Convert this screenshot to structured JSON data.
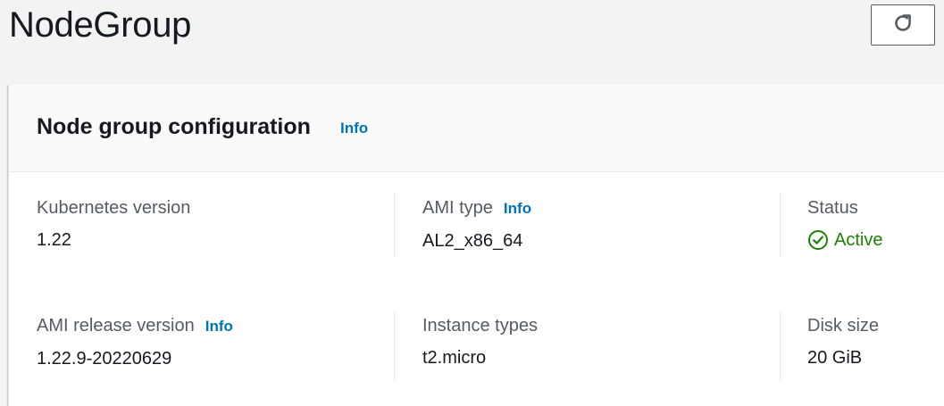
{
  "page": {
    "title": "NodeGroup"
  },
  "refresh_button": {
    "icon": "refresh-icon"
  },
  "card": {
    "title": "Node group configuration",
    "info_label": "Info",
    "fields": {
      "kubernetes_version": {
        "label": "Kubernetes version",
        "value": "1.22"
      },
      "ami_type": {
        "label": "AMI type",
        "info_label": "Info",
        "value": "AL2_x86_64"
      },
      "status": {
        "label": "Status",
        "value": "Active",
        "color": "#1d8102",
        "icon": "status-success-icon"
      },
      "ami_release_version": {
        "label": "AMI release version",
        "info_label": "Info",
        "value": "1.22.9-20220629"
      },
      "instance_types": {
        "label": "Instance types",
        "value": "t2.micro"
      },
      "disk_size": {
        "label": "Disk size",
        "value": "20 GiB"
      }
    }
  }
}
